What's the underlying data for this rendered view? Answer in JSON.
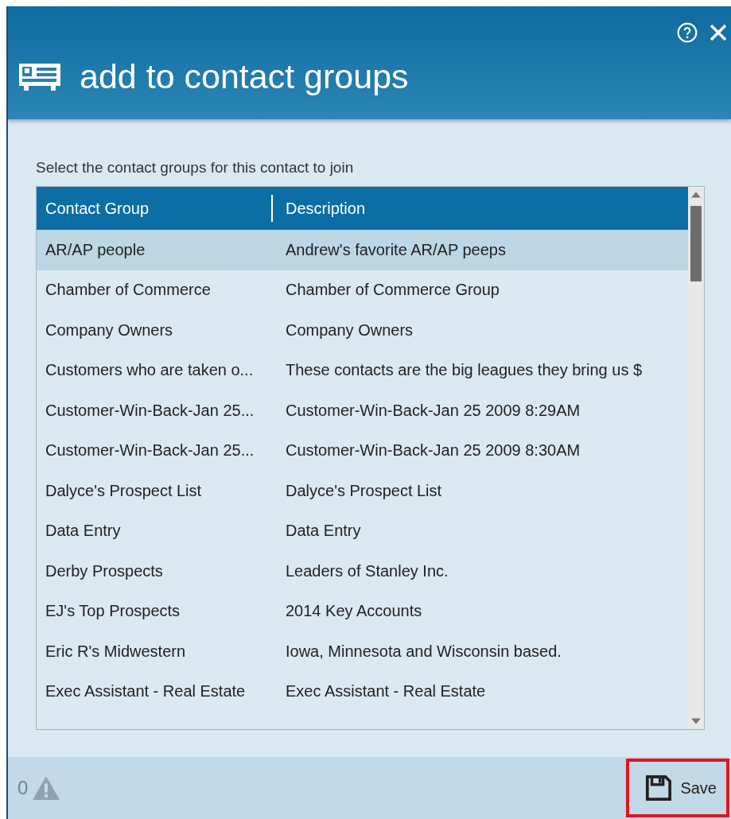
{
  "window": {
    "title": "add to contact groups"
  },
  "instruction": "Select the contact groups for this contact to join",
  "table": {
    "columns": [
      "Contact Group",
      "Description"
    ],
    "rows": [
      {
        "cells": [
          "AR/AP people",
          "Andrew's favorite AR/AP peeps"
        ],
        "selected": true
      },
      {
        "cells": [
          "Chamber of Commerce",
          "Chamber of Commerce Group"
        ],
        "selected": false
      },
      {
        "cells": [
          "Company Owners",
          "Company Owners"
        ],
        "selected": false
      },
      {
        "cells": [
          "Customers who are taken o...",
          "These contacts are the big leagues they bring us $"
        ],
        "selected": false
      },
      {
        "cells": [
          "Customer-Win-Back-Jan 25...",
          "Customer-Win-Back-Jan 25 2009  8:29AM"
        ],
        "selected": false
      },
      {
        "cells": [
          "Customer-Win-Back-Jan 25...",
          "Customer-Win-Back-Jan 25 2009  8:30AM"
        ],
        "selected": false
      },
      {
        "cells": [
          "Dalyce's Prospect List",
          "Dalyce's Prospect List"
        ],
        "selected": false
      },
      {
        "cells": [
          "Data Entry",
          "Data Entry"
        ],
        "selected": false
      },
      {
        "cells": [
          "Derby Prospects",
          "Leaders of Stanley Inc."
        ],
        "selected": false
      },
      {
        "cells": [
          "EJ's Top Prospects",
          "2014 Key Accounts"
        ],
        "selected": false
      },
      {
        "cells": [
          "Eric R's Midwestern",
          "Iowa, Minnesota and Wisconsin based."
        ],
        "selected": false
      },
      {
        "cells": [
          "Exec Assistant - Real Estate",
          "Exec Assistant - Real Estate"
        ],
        "selected": false
      }
    ]
  },
  "footer": {
    "warning_count": "0",
    "save": {
      "label": "Save",
      "highlighted": true
    }
  }
}
